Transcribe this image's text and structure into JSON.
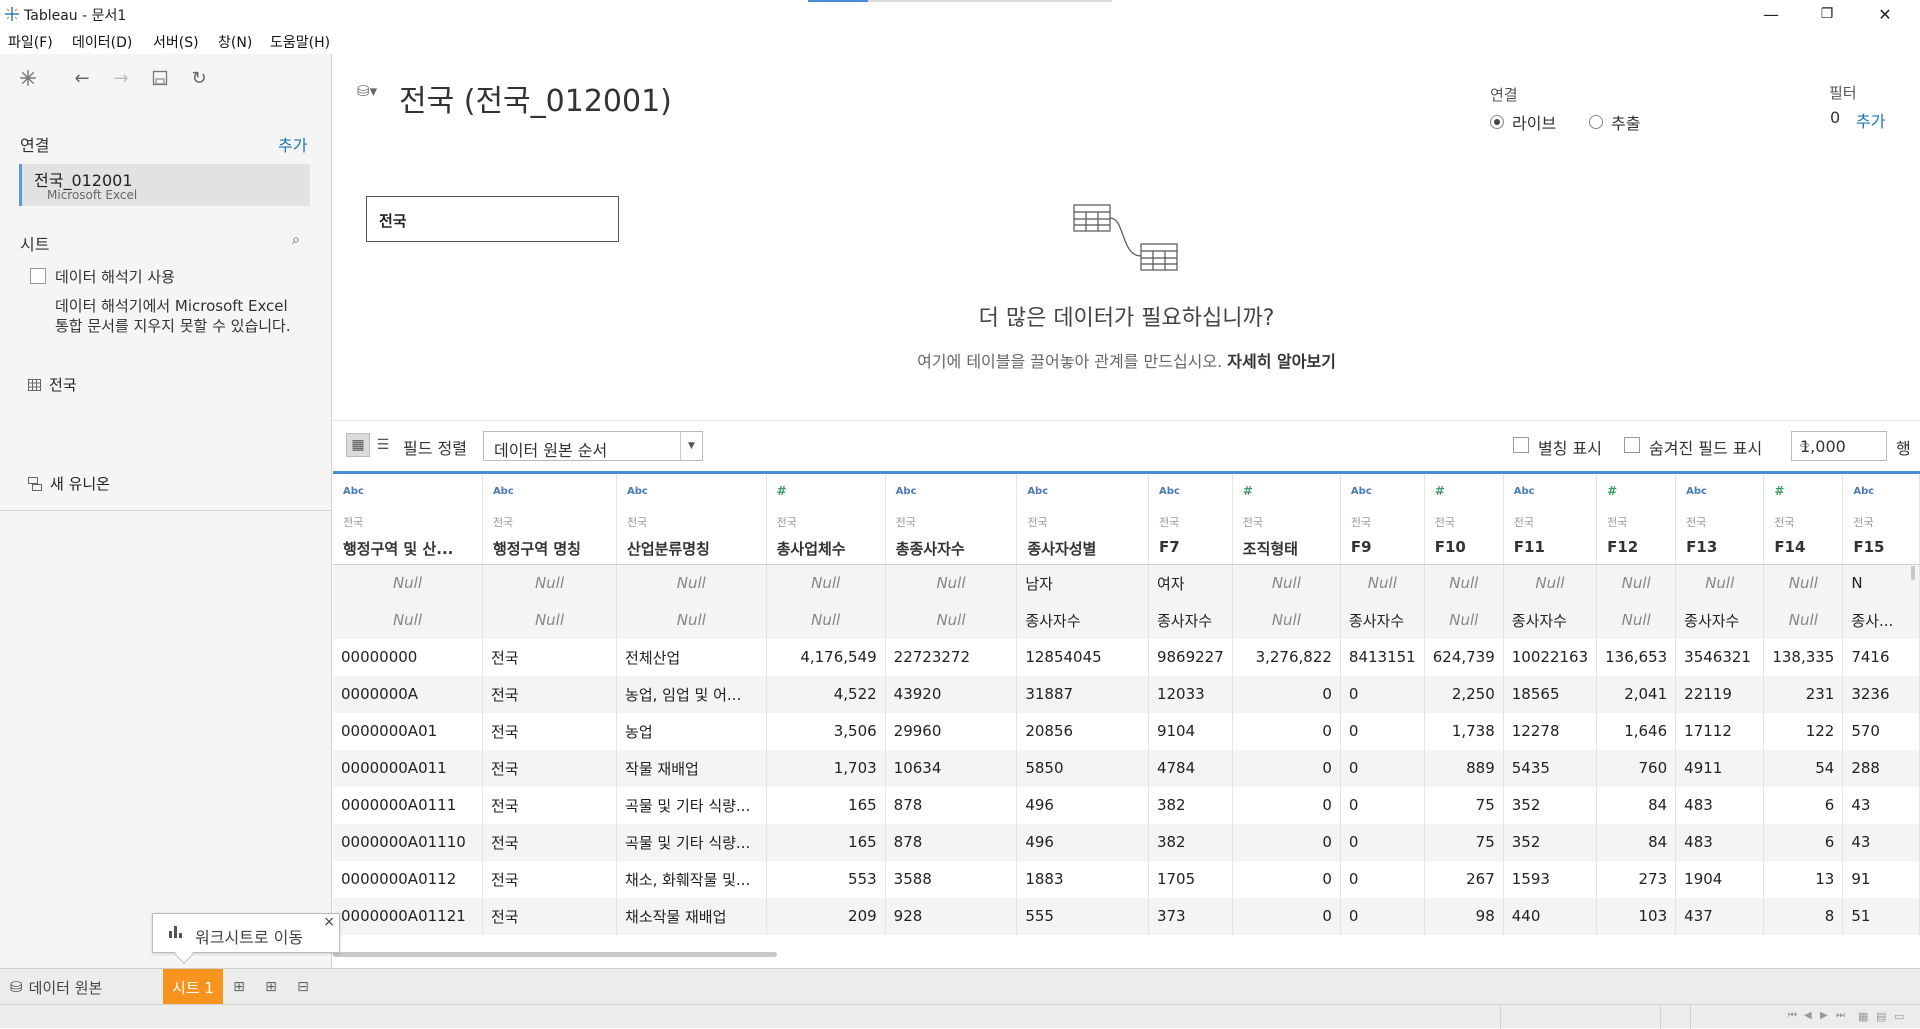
{
  "window": {
    "title": "Tableau - 문서1",
    "minimize": "—",
    "restore": "❐",
    "close": "✕"
  },
  "menu": [
    "파일(F)",
    "데이터(D)",
    "서버(S)",
    "창(N)",
    "도움말(H)"
  ],
  "left": {
    "connections_title": "연결",
    "connections_add": "추가",
    "connection": {
      "name": "전국_012001",
      "type": "Microsoft Excel"
    },
    "sheets_title": "시트",
    "interpreter_label": "데이터 해석기 사용",
    "interpreter_desc": "데이터 해석기에서 Microsoft Excel 통합 문서를 지우지 못할 수 있습니다.",
    "sheet_name": "전국",
    "new_union": "새 유니온"
  },
  "canvas": {
    "title": "전국 (전국_012001)",
    "connection_label": "연결",
    "live": "라이브",
    "extract": "추출",
    "filter_label": "필터",
    "filter_count": "0",
    "filter_add": "추가",
    "table_name": "전국",
    "more_data": "더 많은 데이터가 필요하십니까?",
    "drag_hint": "여기에 테이블을 끌어놓아 관계를 만드십시오.",
    "learn_more": "자세히 알아보기"
  },
  "gridbar": {
    "sort_label": "필드 정렬",
    "sort_value": "데이터 원본 순서",
    "alias_label": "별칭 표시",
    "hidden_label": "숨겨진 필드 표시",
    "rows_value": "1,000",
    "rows_suffix": "행"
  },
  "grid": {
    "columns": [
      {
        "type": "Abc",
        "src": "전국",
        "name": "행정구역 및 산...",
        "num": false
      },
      {
        "type": "Abc",
        "src": "전국",
        "name": "행정구역 명칭",
        "num": false
      },
      {
        "type": "Abc",
        "src": "전국",
        "name": "산업분류명칭",
        "num": false
      },
      {
        "type": "#",
        "src": "전국",
        "name": "총사업체수",
        "num": true
      },
      {
        "type": "Abc",
        "src": "전국",
        "name": "총종사자수",
        "num": false
      },
      {
        "type": "Abc",
        "src": "전국",
        "name": "종사자성별",
        "num": false
      },
      {
        "type": "Abc",
        "src": "전국",
        "name": "F7",
        "num": false
      },
      {
        "type": "#",
        "src": "전국",
        "name": "조직형태",
        "num": true
      },
      {
        "type": "Abc",
        "src": "전국",
        "name": "F9",
        "num": false
      },
      {
        "type": "#",
        "src": "전국",
        "name": "F10",
        "num": true
      },
      {
        "type": "Abc",
        "src": "전국",
        "name": "F11",
        "num": false
      },
      {
        "type": "#",
        "src": "전국",
        "name": "F12",
        "num": true
      },
      {
        "type": "Abc",
        "src": "전국",
        "name": "F13",
        "num": false
      },
      {
        "type": "#",
        "src": "전국",
        "name": "F14",
        "num": true
      },
      {
        "type": "Abc",
        "src": "전국",
        "name": "F15",
        "num": false
      }
    ],
    "rows": [
      [
        "Null",
        "Null",
        "Null",
        "Null",
        "Null",
        "남자",
        "여자",
        "Null",
        "Null",
        "Null",
        "Null",
        "Null",
        "Null",
        "Null",
        "N"
      ],
      [
        "Null",
        "Null",
        "Null",
        "Null",
        "Null",
        "종사자수",
        "종사자수",
        "Null",
        "종사자수",
        "Null",
        "종사자수",
        "Null",
        "종사자수",
        "Null",
        "종사..."
      ],
      [
        "00000000",
        "전국",
        "전체산업",
        "4,176,549",
        "22723272",
        "12854045",
        "9869227",
        "3,276,822",
        "8413151",
        "624,739",
        "10022163",
        "136,653",
        "3546321",
        "138,335",
        "7416"
      ],
      [
        "0000000A",
        "전국",
        "농업, 임업 및 어...",
        "4,522",
        "43920",
        "31887",
        "12033",
        "0",
        "0",
        "2,250",
        "18565",
        "2,041",
        "22119",
        "231",
        "3236"
      ],
      [
        "0000000A01",
        "전국",
        "농업",
        "3,506",
        "29960",
        "20856",
        "9104",
        "0",
        "0",
        "1,738",
        "12278",
        "1,646",
        "17112",
        "122",
        "570"
      ],
      [
        "0000000A011",
        "전국",
        "작물 재배업",
        "1,703",
        "10634",
        "5850",
        "4784",
        "0",
        "0",
        "889",
        "5435",
        "760",
        "4911",
        "54",
        "288"
      ],
      [
        "0000000A0111",
        "전국",
        "곡물 및 기타 식량...",
        "165",
        "878",
        "496",
        "382",
        "0",
        "0",
        "75",
        "352",
        "84",
        "483",
        "6",
        "43"
      ],
      [
        "0000000A01110",
        "전국",
        "곡물 및 기타 식량...",
        "165",
        "878",
        "496",
        "382",
        "0",
        "0",
        "75",
        "352",
        "84",
        "483",
        "6",
        "43"
      ],
      [
        "0000000A0112",
        "전국",
        "채소, 화훼작물 및...",
        "553",
        "3588",
        "1883",
        "1705",
        "0",
        "0",
        "267",
        "1593",
        "273",
        "1904",
        "13",
        "91"
      ],
      [
        "0000000A01121",
        "전국",
        "채소작물 재배업",
        "209",
        "928",
        "555",
        "373",
        "0",
        "0",
        "98",
        "440",
        "103",
        "437",
        "8",
        "51"
      ]
    ]
  },
  "tooltip": {
    "label": "워크시트로 이동",
    "close": "×"
  },
  "tabs": {
    "datasource": "데이터 원본",
    "sheet1": "시트 1"
  }
}
